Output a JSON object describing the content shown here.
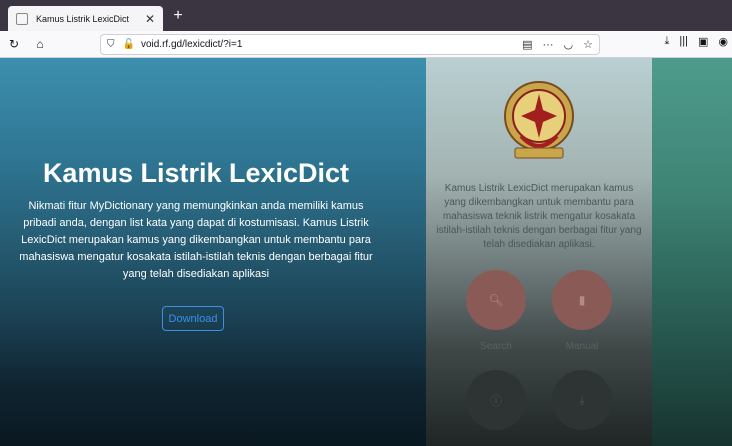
{
  "browser": {
    "tab": {
      "title": "Kamus Listrik LexicDict"
    },
    "url": "void.rf.gd/lexicdict/?i=1"
  },
  "hero": {
    "title": "Kamus Listrik LexicDict",
    "description": "Nikmati fitur MyDictionary yang memungkinkan anda memiliki kamus pribadi anda, dengan list kata yang dapat di kostumisasi. Kamus Listrik LexicDict merupakan kamus yang dikembangkan untuk membantu para mahasiswa mengatur kosakata istilah-istilah teknis dengan berbagai fitur yang telah disediakan aplikasi",
    "download_label": "Download"
  },
  "side": {
    "description": "Kamus Listrik LexicDict merupakan kamus yang dikembangkan untuk membantu para mahasiswa teknik listrik mengatur kosakata istilah-istilah teknis dengan berbagai fitur yang telah disediakan aplikasi.",
    "buttons": [
      {
        "label": "Search",
        "icon": "search-icon"
      },
      {
        "label": "Manual",
        "icon": "book-icon"
      },
      {
        "label": "",
        "icon": "info-icon"
      },
      {
        "label": "",
        "icon": "download-icon"
      }
    ]
  },
  "colors": {
    "accent": "#3e8ee8",
    "circle": "#8a5a56"
  }
}
